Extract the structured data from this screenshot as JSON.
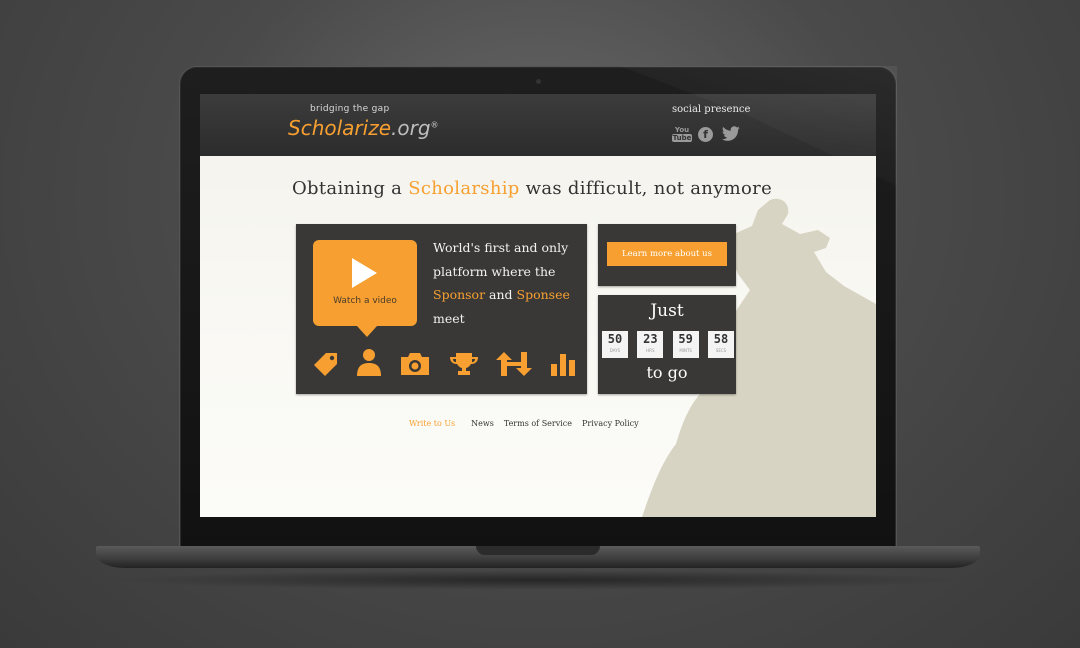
{
  "logo": {
    "tagline": "bridging the gap",
    "wordmark_main": "Scholarize",
    "wordmark_suffix": ".org",
    "registered": "®"
  },
  "social": {
    "label": "social presence",
    "icons": [
      "youtube-icon",
      "facebook-icon",
      "twitter-icon"
    ],
    "youtube_text_top": "You",
    "youtube_text_bottom": "Tube",
    "facebook_text": "f"
  },
  "headline": {
    "before": "Obtaining a ",
    "highlight": "Scholarship",
    "after": " was difficult, not anymore"
  },
  "video": {
    "label": "Watch a video"
  },
  "pitch": {
    "line1": "World's first and only",
    "line2": "platform where the",
    "sponsor": "Sponsor",
    "and": " and ",
    "sponsee": "Sponsee",
    "line4": "meet"
  },
  "feature_icons": [
    "tag-icon",
    "person-icon",
    "camera-icon",
    "trophy-icon",
    "exchange-icon",
    "bar-chart-icon"
  ],
  "about": {
    "button_label": "Learn more about us"
  },
  "countdown": {
    "prefix": "Just",
    "suffix": "to go",
    "units": [
      {
        "value": "50",
        "unit": "DAYS"
      },
      {
        "value": "23",
        "unit": "HRS"
      },
      {
        "value": "59",
        "unit": "MINTS"
      },
      {
        "value": "58",
        "unit": "SECS"
      }
    ]
  },
  "footer": {
    "links": [
      "Write to Us",
      "News",
      "Terms of Service",
      "Privacy Policy"
    ]
  },
  "colors": {
    "accent": "#f7a031",
    "card": "#3a3836",
    "header": "#333333",
    "page_bg": "#f6f5ef"
  }
}
